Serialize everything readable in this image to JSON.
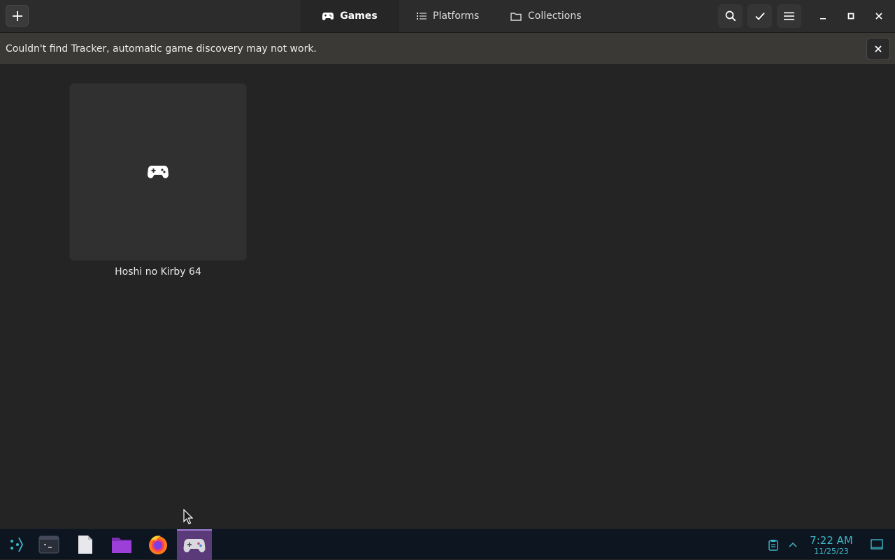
{
  "header": {
    "tabs": [
      {
        "label": "Games",
        "icon": "gamepad-icon",
        "active": true
      },
      {
        "label": "Platforms",
        "icon": "list-icon",
        "active": false
      },
      {
        "label": "Collections",
        "icon": "folder-icon",
        "active": false
      }
    ]
  },
  "infobar": {
    "message": "Couldn't find Tracker, automatic game discovery may not work."
  },
  "games": [
    {
      "title": "Hoshi no Kirby 64",
      "icon": "gamepad-icon"
    }
  ],
  "taskbar": {
    "apps": [
      {
        "name": "app-launcher",
        "icon": "launcher-icon"
      },
      {
        "name": "terminal",
        "icon": "terminal-icon"
      },
      {
        "name": "text-editor",
        "icon": "document-icon"
      },
      {
        "name": "file-manager",
        "icon": "folder-icon"
      },
      {
        "name": "firefox",
        "icon": "firefox-icon"
      },
      {
        "name": "games",
        "icon": "gamepad-icon",
        "active": true
      }
    ],
    "clock": {
      "time": "7:22 AM",
      "date": "11/25/23"
    }
  },
  "colors": {
    "background": "#242424",
    "headerbar": "#2c2c2c",
    "infobar": "#3a3936",
    "taskbar": "#0d1520",
    "clock": "#3db8c8",
    "active_task": "#5a3a78"
  }
}
